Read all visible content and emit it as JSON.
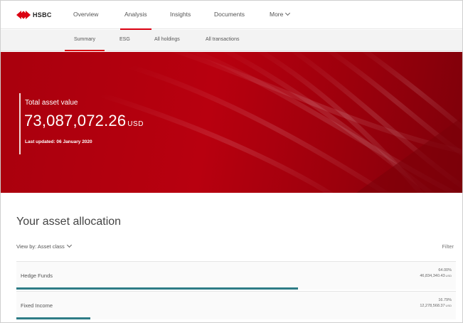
{
  "brand": {
    "name": "HSBC",
    "color": "#db0011"
  },
  "nav": {
    "items": [
      {
        "label": "Overview"
      },
      {
        "label": "Analysis"
      },
      {
        "label": "Insights"
      },
      {
        "label": "Documents"
      },
      {
        "label": "More"
      }
    ],
    "active": "Analysis"
  },
  "subnav": {
    "items": [
      {
        "label": "Summary"
      },
      {
        "label": "ESG"
      },
      {
        "label": "All holdings"
      },
      {
        "label": "All transactions"
      }
    ],
    "active": "Summary"
  },
  "hero": {
    "label": "Total asset value",
    "value": "73,087,072.26",
    "currency": "USD",
    "updated": "Last updated: 06 January 2020"
  },
  "allocation": {
    "title": "Your asset allocation",
    "view_by": "View by: Asset class",
    "filter_label": "Filter",
    "rows": [
      {
        "name": "Hedge Funds",
        "percent": "64.00%",
        "amount": "46,834,340.43",
        "currency": "USD",
        "bar_fraction": 0.64
      },
      {
        "name": "Fixed Income",
        "percent": "16.79%",
        "amount": "12,278,568.37",
        "currency": "USD",
        "bar_fraction": 0.1679
      }
    ],
    "bar_color": "#2e7c86"
  }
}
